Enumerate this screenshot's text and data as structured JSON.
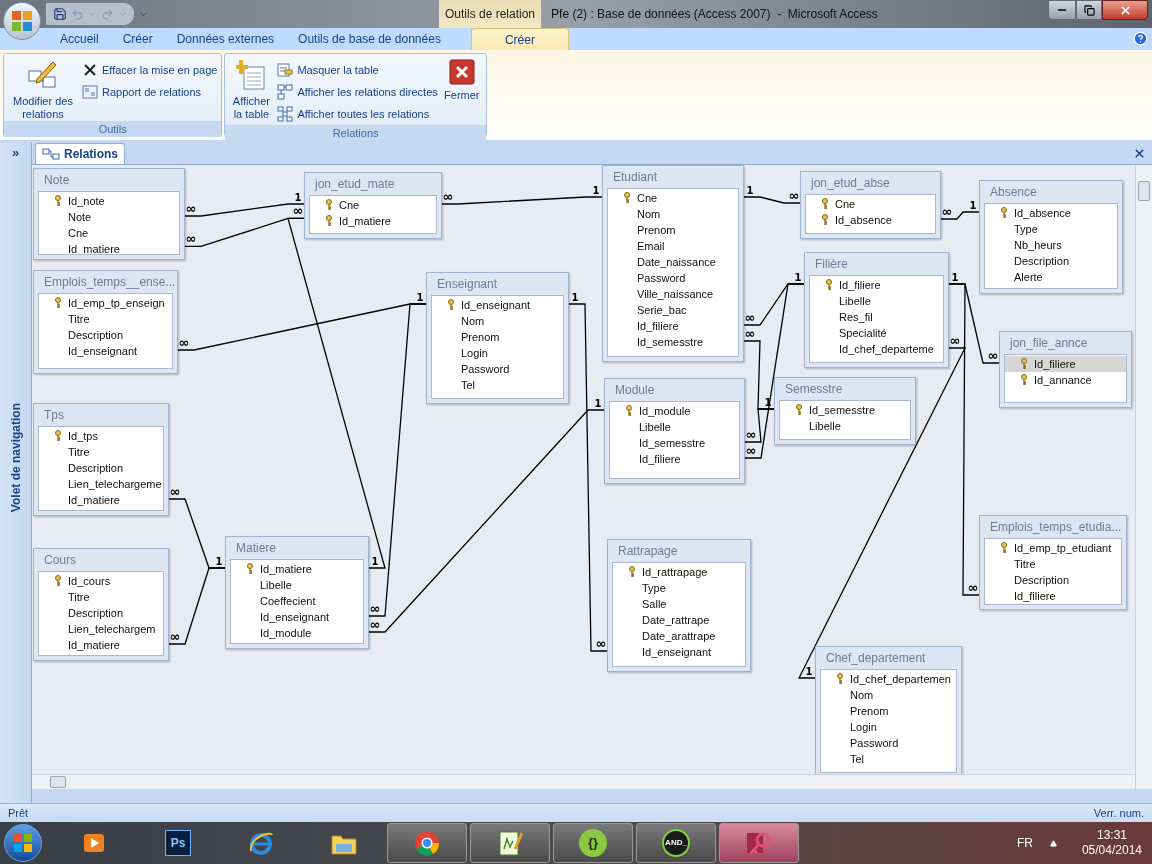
{
  "window": {
    "title": "Pfe (2) : Base de données (Access 2007)  -  Microsoft Access",
    "contextual_group": "Outils de relation"
  },
  "ribbon_tabs": [
    {
      "label": "Accueil",
      "selected": false
    },
    {
      "label": "Créer",
      "selected": false
    },
    {
      "label": "Données externes",
      "selected": false
    },
    {
      "label": "Outils de base de données",
      "selected": false
    },
    {
      "label": "Créer",
      "selected": true
    }
  ],
  "ribbon_groups": [
    {
      "label": "Outils",
      "commands": [
        {
          "kind": "edit-relations",
          "label": "Modifier des relations"
        },
        {
          "kind": "clear-layout",
          "label": "Effacer la mise en page"
        },
        {
          "kind": "relation-report",
          "label": "Rapport de relations"
        }
      ]
    },
    {
      "label": "Relations",
      "commands": [
        {
          "kind": "show-table",
          "label": "Afficher la table"
        },
        {
          "kind": "hide-table",
          "label": "Masquer la table"
        },
        {
          "kind": "direct-relations",
          "label": "Afficher les relations directes"
        },
        {
          "kind": "all-relations",
          "label": "Afficher toutes les relations"
        },
        {
          "kind": "close",
          "label": "Fermer"
        }
      ]
    }
  ],
  "nav_pane": {
    "title": "Volet de navigation",
    "toggle": "»"
  },
  "document_tab": {
    "label": "Relations",
    "selected": true
  },
  "tables": [
    {
      "name": "Note",
      "fields": [
        {
          "name": "Id_note",
          "key": true,
          "selected": false
        },
        {
          "name": "Note",
          "key": false,
          "selected": false
        },
        {
          "name": "Cne",
          "key": false,
          "selected": false
        },
        {
          "name": "Id_matiere",
          "key": false,
          "selected": false
        }
      ]
    },
    {
      "name": "jon_etud_mate",
      "fields": [
        {
          "name": "Cne",
          "key": true,
          "selected": false
        },
        {
          "name": "Id_matiere",
          "key": true,
          "selected": false
        }
      ]
    },
    {
      "name": "Etudiant",
      "fields": [
        {
          "name": "Cne",
          "key": true,
          "selected": false
        },
        {
          "name": "Nom",
          "key": false,
          "selected": false
        },
        {
          "name": "Prenom",
          "key": false,
          "selected": false
        },
        {
          "name": "Email",
          "key": false,
          "selected": false
        },
        {
          "name": "Date_naissance",
          "key": false,
          "selected": false
        },
        {
          "name": "Password",
          "key": false,
          "selected": false
        },
        {
          "name": "Ville_naissance",
          "key": false,
          "selected": false
        },
        {
          "name": "Serie_bac",
          "key": false,
          "selected": false
        },
        {
          "name": "Id_filiere",
          "key": false,
          "selected": false
        },
        {
          "name": "Id_semesstre",
          "key": false,
          "selected": false
        }
      ]
    },
    {
      "name": "jon_etud_abse",
      "fields": [
        {
          "name": "Cne",
          "key": true,
          "selected": false
        },
        {
          "name": "Id_absence",
          "key": true,
          "selected": false
        }
      ]
    },
    {
      "name": "Absence",
      "fields": [
        {
          "name": "Id_absence",
          "key": true,
          "selected": false
        },
        {
          "name": "Type",
          "key": false,
          "selected": false
        },
        {
          "name": "Nb_heurs",
          "key": false,
          "selected": false
        },
        {
          "name": "Description",
          "key": false,
          "selected": false
        },
        {
          "name": "Alerte",
          "key": false,
          "selected": false
        }
      ]
    },
    {
      "name": "Emplois_temps__ense...",
      "fields": [
        {
          "name": "Id_emp_tp_enseign",
          "key": true,
          "selected": false
        },
        {
          "name": "Titre",
          "key": false,
          "selected": false
        },
        {
          "name": "Description",
          "key": false,
          "selected": false
        },
        {
          "name": "Id_enseignant",
          "key": false,
          "selected": false
        }
      ]
    },
    {
      "name": "Enseignant",
      "fields": [
        {
          "name": "Id_enseignant",
          "key": true,
          "selected": false
        },
        {
          "name": "Nom",
          "key": false,
          "selected": false
        },
        {
          "name": "Prenom",
          "key": false,
          "selected": false
        },
        {
          "name": "Login",
          "key": false,
          "selected": false
        },
        {
          "name": "Password",
          "key": false,
          "selected": false
        },
        {
          "name": "Tel",
          "key": false,
          "selected": false
        }
      ]
    },
    {
      "name": "Filière",
      "fields": [
        {
          "name": "Id_filiere",
          "key": true,
          "selected": false
        },
        {
          "name": "Libelle",
          "key": false,
          "selected": false
        },
        {
          "name": "Res_fil",
          "key": false,
          "selected": false
        },
        {
          "name": "Specialité",
          "key": false,
          "selected": false
        },
        {
          "name": "Id_chef_departeme",
          "key": false,
          "selected": false
        }
      ]
    },
    {
      "name": "jon_file_annce",
      "fields": [
        {
          "name": "Id_filiere",
          "key": true,
          "selected": true
        },
        {
          "name": "Id_annance",
          "key": true,
          "selected": false
        }
      ]
    },
    {
      "name": "Module",
      "fields": [
        {
          "name": "Id_module",
          "key": true,
          "selected": false
        },
        {
          "name": "Libelle",
          "key": false,
          "selected": false
        },
        {
          "name": "Id_semesstre",
          "key": false,
          "selected": false
        },
        {
          "name": "Id_filiere",
          "key": false,
          "selected": false
        }
      ]
    },
    {
      "name": "Semesstre",
      "fields": [
        {
          "name": "Id_semesstre",
          "key": true,
          "selected": false
        },
        {
          "name": "Libelle",
          "key": false,
          "selected": false
        }
      ]
    },
    {
      "name": "Tps",
      "fields": [
        {
          "name": "Id_tps",
          "key": true,
          "selected": false
        },
        {
          "name": "Titre",
          "key": false,
          "selected": false
        },
        {
          "name": "Description",
          "key": false,
          "selected": false
        },
        {
          "name": "Lien_telechargeme",
          "key": false,
          "selected": false
        },
        {
          "name": "Id_matiere",
          "key": false,
          "selected": false
        }
      ]
    },
    {
      "name": "Cours",
      "fields": [
        {
          "name": "Id_cours",
          "key": true,
          "selected": false
        },
        {
          "name": "Titre",
          "key": false,
          "selected": false
        },
        {
          "name": "Description",
          "key": false,
          "selected": false
        },
        {
          "name": "Lien_telechargem",
          "key": false,
          "selected": false
        },
        {
          "name": "Id_matiere",
          "key": false,
          "selected": false
        }
      ]
    },
    {
      "name": "Matiere",
      "fields": [
        {
          "name": "Id_matiere",
          "key": true,
          "selected": false
        },
        {
          "name": "Libelle",
          "key": false,
          "selected": false
        },
        {
          "name": "Coeffecient",
          "key": false,
          "selected": false
        },
        {
          "name": "Id_enseignant",
          "key": false,
          "selected": false
        },
        {
          "name": "Id_module",
          "key": false,
          "selected": false
        }
      ]
    },
    {
      "name": "Rattrapage",
      "fields": [
        {
          "name": "Id_rattrapage",
          "key": true,
          "selected": false
        },
        {
          "name": "Type",
          "key": false,
          "selected": false
        },
        {
          "name": "Salle",
          "key": false,
          "selected": false
        },
        {
          "name": "Date_rattrape",
          "key": false,
          "selected": false
        },
        {
          "name": "Date_arattrape",
          "key": false,
          "selected": false
        },
        {
          "name": "Id_enseignant",
          "key": false,
          "selected": false
        }
      ]
    },
    {
      "name": "Emplois_temps_etudia...",
      "fields": [
        {
          "name": "Id_emp_tp_etudiant",
          "key": true,
          "selected": false
        },
        {
          "name": "Titre",
          "key": false,
          "selected": false
        },
        {
          "name": "Description",
          "key": false,
          "selected": false
        },
        {
          "name": "Id_filiere",
          "key": false,
          "selected": false
        }
      ]
    },
    {
      "name": "Chef_departement",
      "fields": [
        {
          "name": "Id_chef_departemen",
          "key": true,
          "selected": false
        },
        {
          "name": "Nom",
          "key": false,
          "selected": false
        },
        {
          "name": "Prenom",
          "key": false,
          "selected": false
        },
        {
          "name": "Login",
          "key": false,
          "selected": false
        },
        {
          "name": "Password",
          "key": false,
          "selected": false
        },
        {
          "name": "Tel",
          "key": false,
          "selected": false
        }
      ]
    }
  ],
  "relations": [
    {
      "from_label": "∞",
      "to_label": "1"
    },
    {
      "from_label": "∞",
      "to_label": "1"
    },
    {
      "from_label": "1",
      "to_label": "∞"
    },
    {
      "from_label": "∞",
      "to_label": "1"
    },
    {
      "from_label": "∞",
      "to_label": "∞"
    },
    {
      "from_label": "1"
    },
    {
      "from_label": "∞",
      "to_label": "1"
    },
    {
      "from_label": "∞"
    },
    {
      "from_label": "1",
      "to_label": "∞"
    },
    {
      "to_label": "∞"
    },
    {
      "from_label": "∞",
      "to_label": "1"
    },
    {
      "from_label": "∞"
    },
    {
      "from_label": "1",
      "to_label": "∞"
    },
    {
      "from_label": "∞",
      "to_label": "1"
    },
    {
      "from_label": "∞",
      "to_label": "1"
    },
    {
      "from_label": "∞"
    },
    {
      "from_label": "∞",
      "to_label": "1"
    },
    {
      "from_label": "∞",
      "to_label": "1"
    },
    {
      "from_label": "∞"
    }
  ],
  "status_bar": {
    "left": "Prêt",
    "right": "Verr. num."
  },
  "taskbar": {
    "items": [
      {
        "kind": "media",
        "running": false,
        "active": false
      },
      {
        "kind": "photoshop",
        "text": "Ps",
        "running": false,
        "active": false
      },
      {
        "kind": "browser-e",
        "running": false,
        "active": false
      },
      {
        "kind": "folder",
        "running": false,
        "active": false
      },
      {
        "kind": "chrome",
        "running": true,
        "active": false
      },
      {
        "kind": "notepad",
        "running": true,
        "active": false
      },
      {
        "kind": "braces",
        "text": "{}",
        "running": true,
        "active": false
      },
      {
        "kind": "and",
        "text": "AND_",
        "running": true,
        "active": false
      },
      {
        "kind": "access",
        "running": true,
        "active": true
      }
    ],
    "language": "FR",
    "time": "13:31",
    "date": "05/04/2014"
  }
}
